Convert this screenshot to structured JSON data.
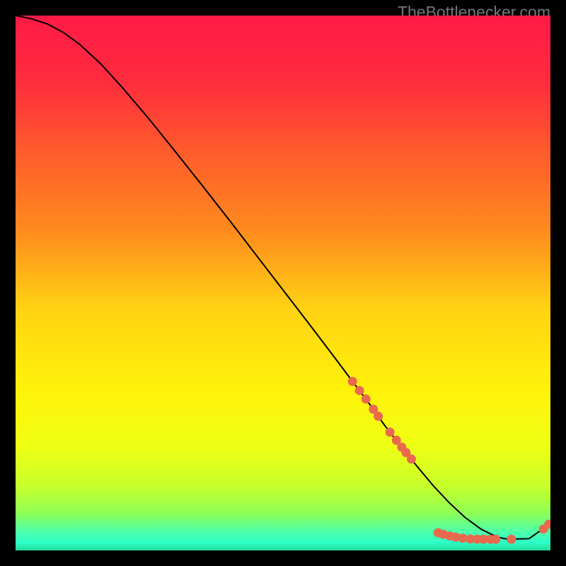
{
  "watermark": "TheBottlenecker.com",
  "chart_data": {
    "type": "line",
    "title": "",
    "xlabel": "",
    "ylabel": "",
    "xlim": [
      0,
      100
    ],
    "ylim": [
      0,
      100
    ],
    "background_gradient": {
      "stops": [
        {
          "pos": 0.0,
          "color": "#ff1a46"
        },
        {
          "pos": 0.12,
          "color": "#ff2b3e"
        },
        {
          "pos": 0.25,
          "color": "#ff5a2c"
        },
        {
          "pos": 0.4,
          "color": "#ff8a1e"
        },
        {
          "pos": 0.55,
          "color": "#ffd312"
        },
        {
          "pos": 0.7,
          "color": "#fff20a"
        },
        {
          "pos": 0.8,
          "color": "#f0ff12"
        },
        {
          "pos": 0.88,
          "color": "#c7ff2a"
        },
        {
          "pos": 0.93,
          "color": "#8eff55"
        },
        {
          "pos": 0.965,
          "color": "#4dffaa"
        },
        {
          "pos": 0.985,
          "color": "#2dffc8"
        },
        {
          "pos": 1.0,
          "color": "#24d99a"
        }
      ]
    },
    "curve": {
      "x": [
        0,
        3,
        6,
        9,
        12,
        16,
        20,
        25,
        30,
        35,
        40,
        45,
        50,
        55,
        60,
        63,
        66,
        69,
        72,
        75,
        78,
        81,
        84,
        87,
        90,
        92,
        96,
        100
      ],
      "y": [
        100,
        99.4,
        98.4,
        96.8,
        94.6,
        90.9,
        86.5,
        80.6,
        74.4,
        68.1,
        61.7,
        55.2,
        48.7,
        42.2,
        35.6,
        31.6,
        27.6,
        23.4,
        19.5,
        15.8,
        12.2,
        9.0,
        6.2,
        4.0,
        2.5,
        2.1,
        2.2,
        5.0
      ]
    },
    "dots": [
      {
        "x": 63.0,
        "y": 31.6
      },
      {
        "x": 64.3,
        "y": 29.9
      },
      {
        "x": 65.5,
        "y": 28.3
      },
      {
        "x": 66.9,
        "y": 26.4
      },
      {
        "x": 67.8,
        "y": 25.1
      },
      {
        "x": 70.0,
        "y": 22.1
      },
      {
        "x": 71.2,
        "y": 20.6
      },
      {
        "x": 72.2,
        "y": 19.3
      },
      {
        "x": 73.0,
        "y": 18.3
      },
      {
        "x": 74.0,
        "y": 17.1
      },
      {
        "x": 79.0,
        "y": 3.3
      },
      {
        "x": 80.0,
        "y": 3.0
      },
      {
        "x": 81.2,
        "y": 2.7
      },
      {
        "x": 82.3,
        "y": 2.5
      },
      {
        "x": 83.6,
        "y": 2.3
      },
      {
        "x": 85.0,
        "y": 2.15
      },
      {
        "x": 86.3,
        "y": 2.1
      },
      {
        "x": 87.5,
        "y": 2.1
      },
      {
        "x": 88.8,
        "y": 2.1
      },
      {
        "x": 89.8,
        "y": 2.08
      },
      {
        "x": 92.7,
        "y": 2.1
      },
      {
        "x": 98.7,
        "y": 4.0
      },
      {
        "x": 99.7,
        "y": 4.9
      }
    ],
    "colors": {
      "curve": "#000000",
      "dot_fill": "#e9694f",
      "dot_stroke": "#e9694f"
    }
  }
}
